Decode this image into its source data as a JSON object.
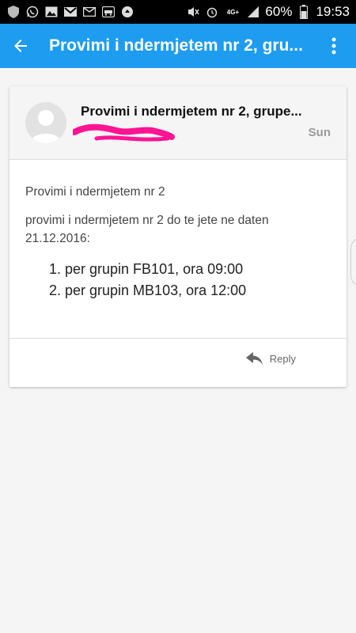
{
  "statusbar": {
    "network_label": "4G+",
    "battery_percent": "60%",
    "time": "19:53",
    "left_icons": [
      "shield-icon",
      "whatsapp-icon",
      "image-icon",
      "gmail-icon",
      "email-icon",
      "car-icon",
      "lock-shield-icon"
    ],
    "right_icons": [
      "mute-icon",
      "alarm-icon",
      "signal-icon",
      "battery-icon"
    ]
  },
  "appbar": {
    "title": "Provimi i ndermjetem nr 2, gru...",
    "back_icon": "arrow-left-icon",
    "menu_icon": "more-vert-icon"
  },
  "email": {
    "subject": "Provimi i ndermjetem nr 2, grupe...",
    "date": "Sun",
    "avatar_icon": "person-avatar-icon",
    "body_title": "Provimi i ndermjetem nr 2",
    "body_text": "provimi i ndermjetem nr 2 do te jete ne daten 21.12.2016:",
    "list": [
      "per grupin FB101, ora 09:00",
      "per grupin MB103, ora 12:00"
    ],
    "reply_label": "Reply"
  },
  "colors": {
    "appbar": "#1e9cf0",
    "scribble": "#ff1493",
    "background": "#f5f5f5"
  }
}
